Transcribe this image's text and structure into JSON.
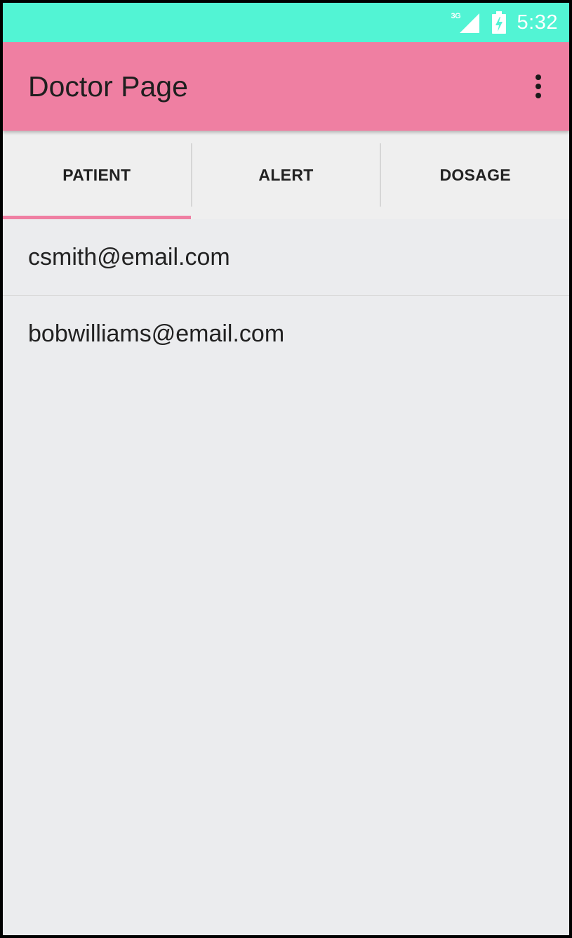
{
  "status_bar": {
    "network_type": "3G",
    "time": "5:32",
    "signal_icon": "cell-signal-icon",
    "battery_icon": "battery-charging-icon",
    "color": "#52F4D4"
  },
  "app_bar": {
    "title": "Doctor Page",
    "menu_icon": "more-vert-icon",
    "color": "#EF7FA2"
  },
  "tabs": [
    {
      "label": "PATIENT",
      "selected": true
    },
    {
      "label": "ALERT",
      "selected": false
    },
    {
      "label": "DOSAGE",
      "selected": false
    }
  ],
  "patients": [
    {
      "email": "csmith@email.com"
    },
    {
      "email": "bobwilliams@email.com"
    }
  ]
}
